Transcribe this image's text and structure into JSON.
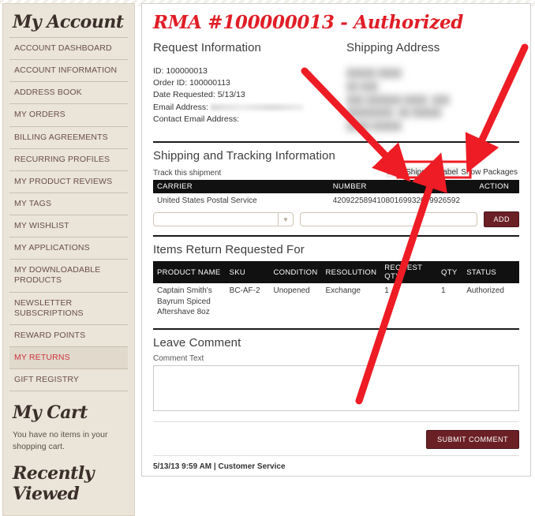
{
  "sidebar": {
    "account_title": "My Account",
    "items": [
      {
        "label": "ACCOUNT DASHBOARD",
        "active": false
      },
      {
        "label": "ACCOUNT INFORMATION",
        "active": false
      },
      {
        "label": "ADDRESS BOOK",
        "active": false
      },
      {
        "label": "MY ORDERS",
        "active": false
      },
      {
        "label": "BILLING AGREEMENTS",
        "active": false
      },
      {
        "label": "RECURRING PROFILES",
        "active": false
      },
      {
        "label": "MY PRODUCT REVIEWS",
        "active": false
      },
      {
        "label": "MY TAGS",
        "active": false
      },
      {
        "label": "MY WISHLIST",
        "active": false
      },
      {
        "label": "MY APPLICATIONS",
        "active": false
      },
      {
        "label": "MY DOWNLOADABLE PRODUCTS",
        "active": false
      },
      {
        "label": "NEWSLETTER SUBSCRIPTIONS",
        "active": false
      },
      {
        "label": "REWARD POINTS",
        "active": false
      },
      {
        "label": "MY RETURNS",
        "active": true
      },
      {
        "label": "GIFT REGISTRY",
        "active": false
      }
    ],
    "cart_title": "My Cart",
    "cart_empty": "You have no items in your shopping cart.",
    "recently_viewed_title": "Recently Viewed"
  },
  "main": {
    "title": "RMA #100000013 - Authorized",
    "request_info_heading": "Request Information",
    "shipping_address_heading": "Shipping Address",
    "request_info": {
      "id_label": "ID: 100000013",
      "order_id_label": "Order ID: 100000113",
      "date_requested_label": "Date Requested: 5/13/13",
      "email_label": "Email Address:",
      "contact_email_label": "Contact Email Address:"
    },
    "shipping_tracking_heading": "Shipping and Tracking Information",
    "track_this_shipment": "Track this shipment",
    "print_shipping_label": "Print Shipping Label",
    "show_packages": "Show Packages",
    "tracking_table": {
      "headers": [
        "CARRIER",
        "NUMBER",
        "ACTION"
      ],
      "rows": [
        {
          "carrier": "United States Postal Service",
          "number": "42092258941080169932099926592",
          "action": ""
        }
      ]
    },
    "add_button": "ADD",
    "carrier_select_value": "",
    "number_input_value": "",
    "items_heading": "Items Return Requested For",
    "items_table": {
      "headers": [
        "PRODUCT NAME",
        "SKU",
        "CONDITION",
        "RESOLUTION",
        "REQUEST QTY",
        "QTY",
        "STATUS"
      ],
      "rows": [
        {
          "product_name": "Captain Smith's Bayrum Spiced Aftershave 8oz",
          "sku": "BC-AF-2",
          "condition": "Unopened",
          "resolution": "Exchange",
          "request_qty": "1",
          "qty": "1",
          "status": "Authorized"
        }
      ]
    },
    "leave_comment_heading": "Leave Comment",
    "comment_text_label": "Comment Text",
    "comment_value": "",
    "submit_comment_button": "SUBMIT COMMENT",
    "history_entry": "5/13/13 9:59 AM | Customer Service"
  },
  "annotations": {
    "color": "#ee1c25",
    "highlight_box_target": "Print Shipping Label",
    "arrow_count": 3
  },
  "colors": {
    "accent_red": "#e01e26",
    "sidebar_bg": "#eae4d9",
    "button_dark": "#6b2025",
    "table_header_bg": "#111111",
    "annotation_red": "#ee1c25"
  }
}
